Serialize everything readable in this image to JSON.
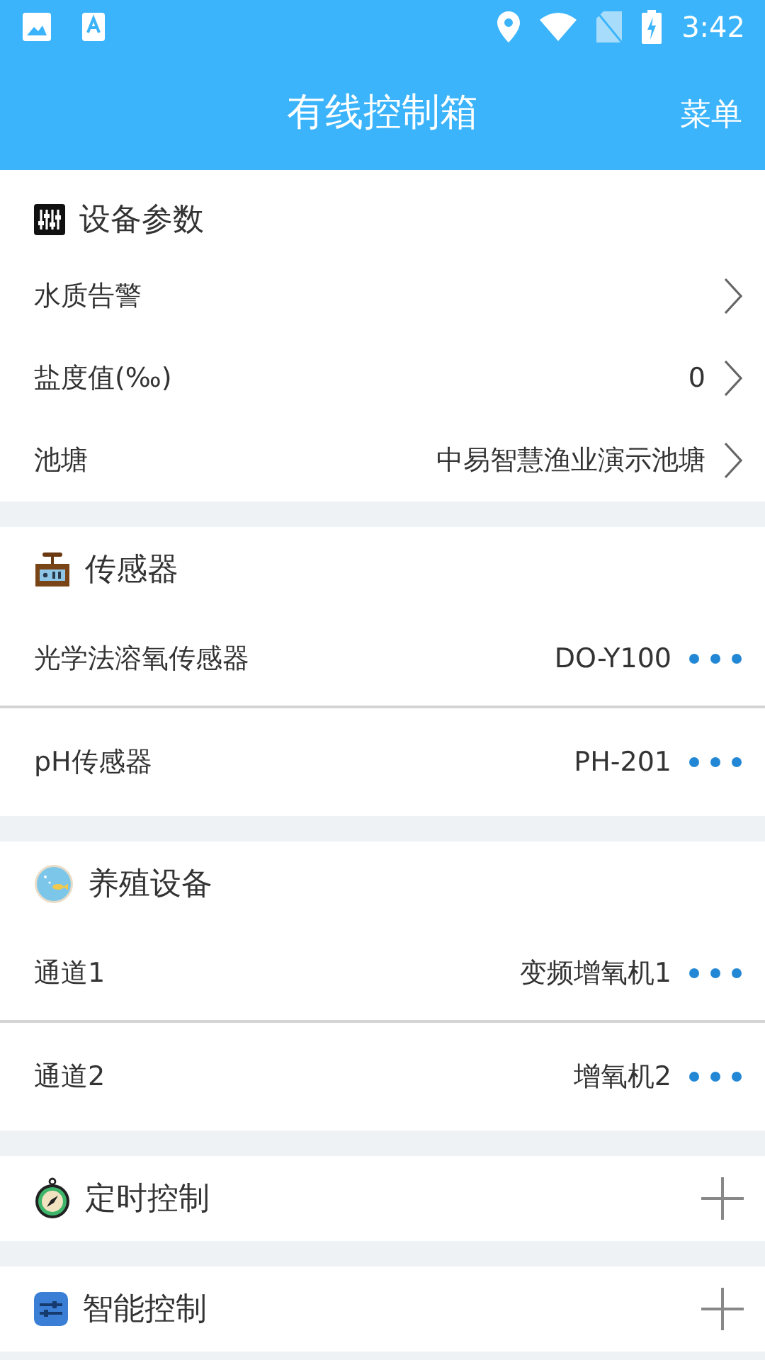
{
  "status_bar": {
    "time": "3:42"
  },
  "header": {
    "title": "有线控制箱",
    "menu": "菜单"
  },
  "sections": [
    {
      "title": "设备参数",
      "rows": [
        {
          "label": "水质告警"
        },
        {
          "label": "盐度值(‰)",
          "value": "0"
        },
        {
          "label": "池塘",
          "value": "中易智慧渔业演示池塘"
        }
      ]
    },
    {
      "title": "传感器",
      "rows": [
        {
          "label": "光学法溶氧传感器",
          "value": "DO-Y100"
        },
        {
          "label": "pH传感器",
          "value": "PH-201"
        }
      ]
    },
    {
      "title": "养殖设备",
      "rows": [
        {
          "label": "通道1",
          "value": "变频增氧机1"
        },
        {
          "label": "通道2",
          "value": "增氧机2"
        }
      ]
    },
    {
      "title": "定时控制"
    },
    {
      "title": "智能控制"
    }
  ]
}
